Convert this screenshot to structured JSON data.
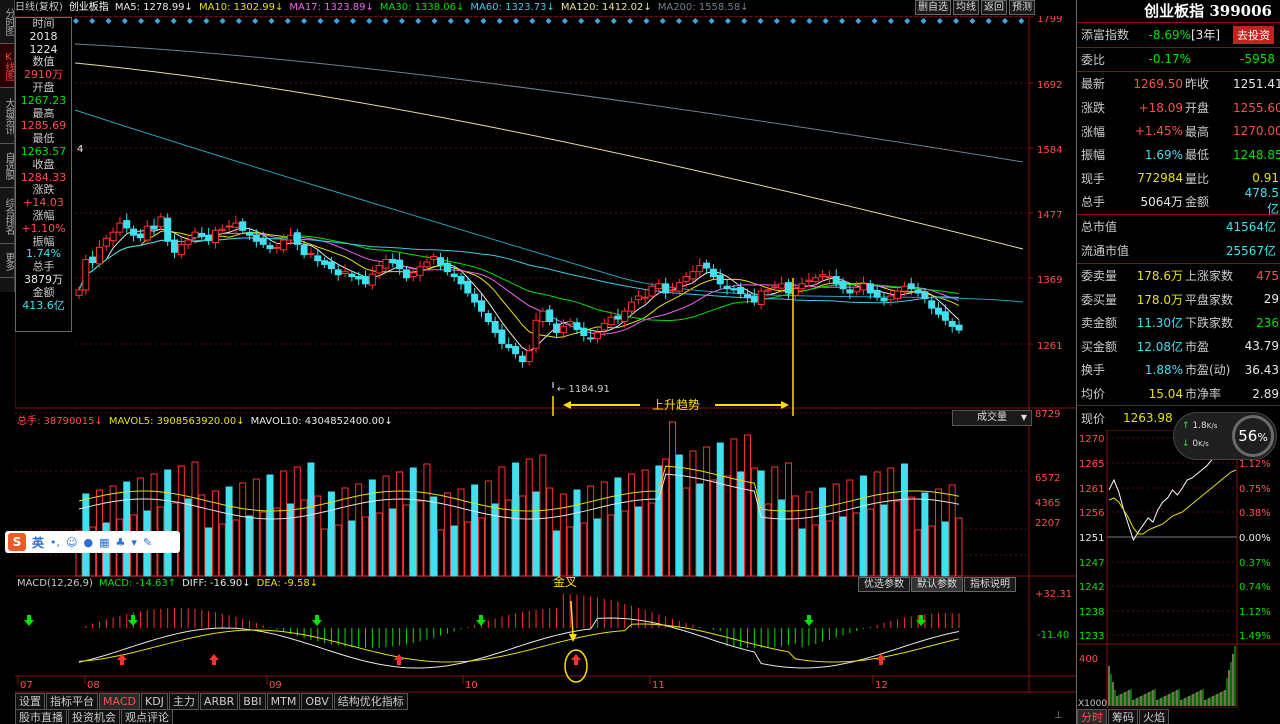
{
  "app": {
    "left_tabs": [
      "分时图",
      "K线图",
      "大盘资讯",
      "自选股",
      "综合排名",
      "更多"
    ],
    "active_left_tab": "K线图"
  },
  "topbar": {
    "period": "日线(复权)",
    "name": "创业板指",
    "ma": [
      {
        "label": "MA5: 1278.99↓",
        "color": "#e8e8e8"
      },
      {
        "label": "MA10: 1302.99↓",
        "color": "#e8e000"
      },
      {
        "label": "MA17: 1323.89↓",
        "color": "#f060f0"
      },
      {
        "label": "MA30: 1338.06↓",
        "color": "#00e000"
      },
      {
        "label": "MA60: 1323.73↓",
        "color": "#40c8e8"
      },
      {
        "label": "MA120: 1412.02↓",
        "color": "#e8e0a0"
      },
      {
        "label": "MA200: 1558.58↓",
        "color": "#708090"
      }
    ],
    "buttons": [
      "删自选",
      "均线",
      "返回",
      "预测"
    ]
  },
  "info_panel": {
    "items": [
      {
        "label": "时间",
        "value": "2018",
        "color": "#e8e8e8"
      },
      {
        "label": "",
        "value": "1224",
        "color": "#e8e8e8"
      },
      {
        "label": "数值",
        "value": "2910万",
        "color": "#ff4d4d"
      },
      {
        "label": "开盘",
        "value": "1267.23",
        "color": "#00e000"
      },
      {
        "label": "最高",
        "value": "1285.69",
        "color": "#ff4d4d"
      },
      {
        "label": "最低",
        "value": "1263.57",
        "color": "#00e000"
      },
      {
        "label": "收盘",
        "value": "1284.33",
        "color": "#ff4d4d"
      },
      {
        "label": "涨跌",
        "value": "+14.03",
        "color": "#ff4d4d"
      },
      {
        "label": "涨幅",
        "value": "+1.10%",
        "color": "#ff4d4d"
      },
      {
        "label": "振幅",
        "value": "1.74%",
        "color": "#40e0f0"
      },
      {
        "label": "总手",
        "value": "3879万",
        "color": "#e8e8e8"
      },
      {
        "label": "金额",
        "value": "413.6亿",
        "color": "#40e0f0"
      }
    ]
  },
  "kline": {
    "price_axis": [
      "1799",
      "1692",
      "1584",
      "1477",
      "1369",
      "1261"
    ],
    "low_marker": "1184.91",
    "trend_label": "上升趋势",
    "ma_label_num": "4"
  },
  "volume": {
    "header": [
      {
        "label": "总手: 38790015↓",
        "color": "#e8e8e8"
      },
      {
        "label": "MAVOL5: 3908563920.00↓",
        "color": "#e8e000"
      },
      {
        "label": "MAVOL10: 4304852400.00↓",
        "color": "#e8e8e8"
      }
    ],
    "dropdown": "成交量",
    "axis": [
      "8729",
      "6572",
      "4365",
      "2207"
    ]
  },
  "macd": {
    "header": [
      {
        "label": "MACD(12,26,9)",
        "color": "#c8c8c8"
      },
      {
        "label": "MACD: -14.63↑",
        "color": "#00e000"
      },
      {
        "label": "DIFF: -16.90↓",
        "color": "#e8e8e8"
      },
      {
        "label": "DEA: -9.58↓",
        "color": "#e8e000"
      }
    ],
    "buttons": [
      "优选参数",
      "默认参数",
      "指标说明"
    ],
    "axis": [
      "+32.31",
      "-11.40"
    ],
    "cross_label": "金叉"
  },
  "x_axis": [
    "07",
    "08",
    "09",
    "10",
    "11",
    "12"
  ],
  "bottom_tabs": [
    "设置",
    "指标平台",
    "MACD",
    "KDJ",
    "主力",
    "ARBR",
    "BBI",
    "MTM",
    "OBV",
    "结构优化指标"
  ],
  "active_bottom_tab": "MACD",
  "news_tabs": [
    "股市直播",
    "投资机会",
    "观点评论"
  ],
  "ime_toolbar": {
    "label": "英"
  },
  "quote": {
    "name": "创业板指 399006",
    "tianfu": {
      "label": "添富指数",
      "value": "-8.69%",
      "period": "[3年]",
      "button": "去投资"
    },
    "weibi": {
      "label": "委比",
      "value": "-0.17%",
      "diff": "-5958"
    },
    "rows": [
      {
        "l1": "最新",
        "v1": "1269.50",
        "c1": "#ff4d4d",
        "l2": "昨收",
        "v2": "1251.41",
        "c2": "#e8e8e8"
      },
      {
        "l1": "涨跌",
        "v1": "+18.09",
        "c1": "#ff4d4d",
        "l2": "开盘",
        "v2": "1255.60",
        "c2": "#ff4d4d"
      },
      {
        "l1": "涨幅",
        "v1": "+1.45%",
        "c1": "#ff4d4d",
        "l2": "最高",
        "v2": "1270.00",
        "c2": "#ff4d4d"
      },
      {
        "l1": "振幅",
        "v1": "1.69%",
        "c1": "#40e0f0",
        "l2": "最低",
        "v2": "1248.85",
        "c2": "#00e000"
      },
      {
        "l1": "现手",
        "v1": "772984",
        "c1": "#e8e000",
        "l2": "量比",
        "v2": "0.91",
        "c2": "#e8e000"
      },
      {
        "l1": "总手",
        "v1": "5064万",
        "c1": "#e8e8e8",
        "l2": "金额",
        "v2": "478.5亿",
        "c2": "#40e0f0"
      }
    ],
    "cap": [
      {
        "label": "总市值",
        "value": "41564亿"
      },
      {
        "label": "流通市值",
        "value": "25567亿"
      }
    ],
    "rows2": [
      {
        "l1": "委卖量",
        "v1": "178.6万",
        "c1": "#e8e000",
        "l2": "上涨家数",
        "v2": "475",
        "c2": "#ff4d4d"
      },
      {
        "l1": "委买量",
        "v1": "178.0万",
        "c1": "#e8e000",
        "l2": "平盘家数",
        "v2": "29",
        "c2": "#e8e8e8"
      },
      {
        "l1": "卖金额",
        "v1": "11.30亿",
        "c1": "#40e0f0",
        "l2": "下跌家数",
        "v2": "236",
        "c2": "#00e000"
      },
      {
        "l1": "买金额",
        "v1": "12.08亿",
        "c1": "#40e0f0",
        "l2": "市盈",
        "v2": "43.79",
        "c2": "#e8e8e8"
      },
      {
        "l1": "换手",
        "v1": "1.88%",
        "c1": "#40e0f0",
        "l2": "市盈(动)",
        "v2": "36.43",
        "c2": "#e8e8e8"
      },
      {
        "l1": "均价",
        "v1": "15.04",
        "c1": "#e8e000",
        "l2": "市净率",
        "v2": "2.89",
        "c2": "#e8e8e8"
      }
    ]
  },
  "mini": {
    "label": "现价",
    "price": "1263.98",
    "left_axis": [
      "1270",
      "1265",
      "1261",
      "1256",
      "1251",
      "1247",
      "1242",
      "1238",
      "1233",
      "400",
      "X1000"
    ],
    "right_axis": [
      "1.49%",
      "1.12%",
      "0.75%",
      "0.38%",
      "0.00%",
      "0.37%",
      "0.74%",
      "1.12%",
      "1.49%"
    ],
    "percent": "56",
    "upload": "1.8",
    "download": "0",
    "speed_unit": "K/s",
    "tabs": [
      "分时",
      "筹码",
      "火焰"
    ]
  }
}
